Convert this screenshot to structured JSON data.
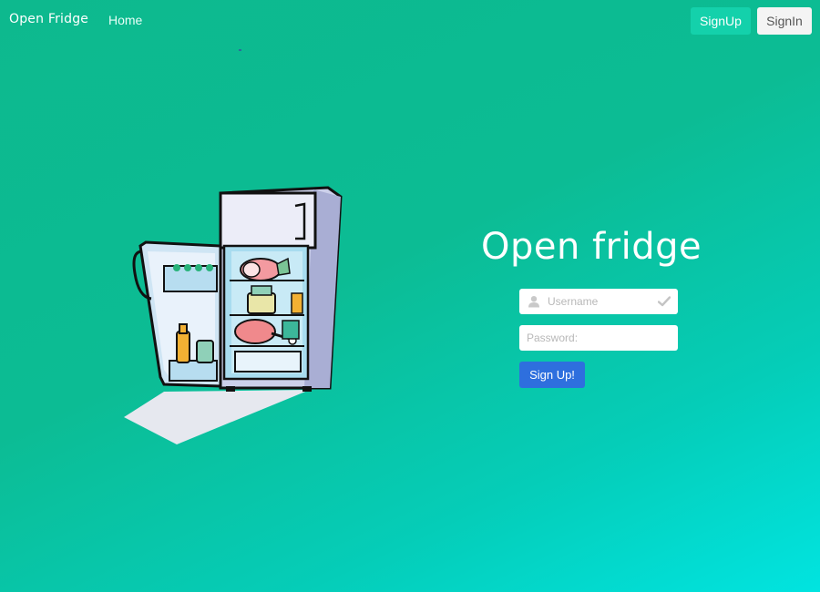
{
  "navbar": {
    "brand": "Open Fridge",
    "home_label": "Home",
    "signup_label": "SignUp",
    "signin_label": "SignIn"
  },
  "hero": {
    "title": "Open fridge"
  },
  "form": {
    "username": {
      "placeholder": "Username",
      "value": "",
      "icon": "user-icon",
      "status_icon": "check-icon"
    },
    "password": {
      "placeholder": "Password:",
      "value": ""
    },
    "submit_label": "Sign Up!"
  },
  "colors": {
    "background_start": "#0db98e",
    "background_end": "#01e4e0",
    "signup_button": "#14d1ab",
    "signin_button": "#f4f4f4",
    "submit_button": "#2e6fde",
    "text_light": "#ffffff"
  },
  "illustration": {
    "subject": "open refrigerator with food"
  }
}
